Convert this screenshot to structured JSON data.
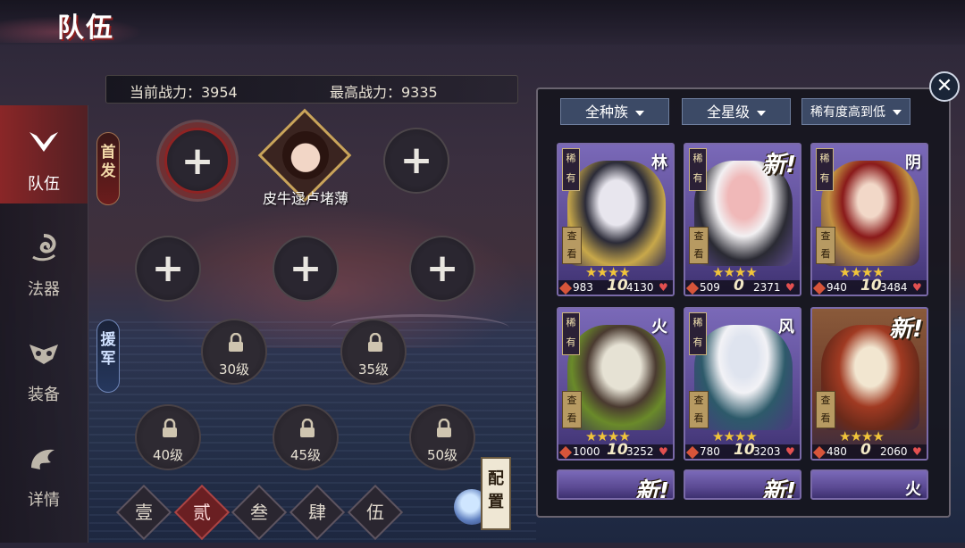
{
  "title": "队伍",
  "sidebar": {
    "items": [
      {
        "label": "队伍",
        "active": true,
        "icon": "team-wing-icon"
      },
      {
        "label": "法器",
        "active": false,
        "icon": "artifact-swirl-icon"
      },
      {
        "label": "装备",
        "active": false,
        "icon": "equipment-mask-icon"
      },
      {
        "label": "详情",
        "active": false,
        "icon": "detail-dragon-icon"
      }
    ]
  },
  "stats": {
    "current_power": "当前战力：3954",
    "max_power": "最高战力：9335"
  },
  "formation": {
    "first_tag": "首发",
    "support_tag": "援军",
    "hero_name": "皮牛逯卢堵薄",
    "locked_levels": [
      "30级",
      "35级",
      "40级",
      "45级",
      "50级"
    ]
  },
  "teams": [
    "壹",
    "贰",
    "叁",
    "肆",
    "伍"
  ],
  "config_label": "配置",
  "filters": {
    "race": "全种族",
    "stars": "全星级",
    "sort": "稀有度高到低"
  },
  "cards": [
    {
      "rare": "稀有",
      "tag": "林",
      "new": false,
      "atk": "983",
      "lv": "10",
      "hp": "4130",
      "stars": "★★★★",
      "view": "查看"
    },
    {
      "rare": "稀有",
      "tag": "",
      "new": true,
      "atk": "509",
      "lv": "0",
      "hp": "2371",
      "stars": "★★★★",
      "view": "查看"
    },
    {
      "rare": "稀有",
      "tag": "阴",
      "new": false,
      "atk": "940",
      "lv": "10",
      "hp": "3484",
      "stars": "★★★★",
      "view": "查看"
    },
    {
      "rare": "稀有",
      "tag": "火",
      "new": false,
      "atk": "1000",
      "lv": "10",
      "hp": "3252",
      "stars": "★★★★",
      "view": "查看"
    },
    {
      "rare": "稀有",
      "tag": "风",
      "new": false,
      "atk": "780",
      "lv": "10",
      "hp": "3203",
      "stars": "★★★★",
      "view": "查看"
    },
    {
      "rare": "",
      "tag": "",
      "new": true,
      "atk": "480",
      "lv": "0",
      "hp": "2060",
      "stars": "★★★★",
      "view": "查看"
    }
  ],
  "peek_cards": [
    {
      "tag": "新!"
    },
    {
      "tag": "新!"
    },
    {
      "tag": "火"
    }
  ],
  "new_label": "新!"
}
